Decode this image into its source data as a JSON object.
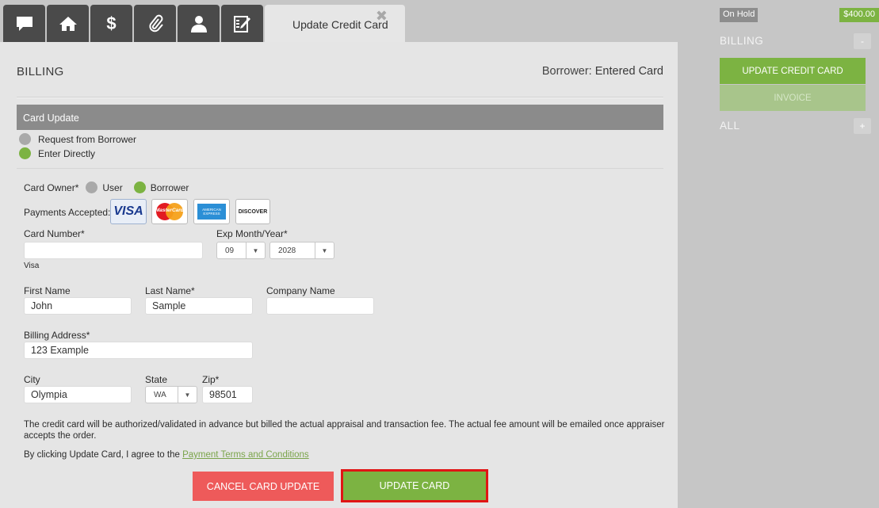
{
  "tabs": {
    "icons": [
      "chat-icon",
      "home-icon",
      "dollar-icon",
      "paperclip-icon",
      "user-icon",
      "edit-icon"
    ],
    "active_title": "Update Credit Card",
    "close_glyph": "✖"
  },
  "main": {
    "title": "BILLING",
    "borrower_prefix": "Borrower:",
    "borrower_value": "Entered Card",
    "section_title": "Card Update",
    "options": {
      "request": "Request from Borrower",
      "direct": "Enter Directly"
    },
    "card_owner": {
      "label": "Card Owner*",
      "user": "User",
      "borrower": "Borrower"
    },
    "payments_label": "Payments Accepted:",
    "cards": {
      "visa": "VISA",
      "mastercard": "MasterCard",
      "amex": "AMERICAN EXPRESS",
      "discover": "DISCOVER"
    },
    "card_number": {
      "label": "Card Number*",
      "value": "",
      "type_note": "Visa"
    },
    "exp": {
      "label": "Exp Month/Year*",
      "month": "09",
      "year": "2028"
    },
    "first_name": {
      "label": "First Name",
      "value": "John"
    },
    "last_name": {
      "label": "Last Name*",
      "value": "Sample"
    },
    "company": {
      "label": "Company Name",
      "value": ""
    },
    "address": {
      "label": "Billing Address*",
      "value": "123 Example"
    },
    "city": {
      "label": "City",
      "value": "Olympia"
    },
    "state": {
      "label": "State",
      "value": "WA"
    },
    "zip": {
      "label": "Zip*",
      "value": "98501"
    },
    "notice": "The credit card will be authorized/validated in advance but billed the actual appraisal and transaction fee. The actual fee amount will be emailed once appraiser accepts the order.",
    "agree_prefix": "By clicking Update Card, I agree to the",
    "agree_link": "Payment Terms and Conditions",
    "cancel_label": "CANCEL CARD UPDATE",
    "update_label": "UPDATE CARD"
  },
  "sidebar": {
    "status": "On Hold",
    "amount": "$400.00",
    "billing_title": "BILLING",
    "billing_toggle": "-",
    "update_cc": "UPDATE CREDIT CARD",
    "invoice": "INVOICE",
    "all_title": "ALL",
    "all_toggle": "+"
  },
  "colors": {
    "accent_green": "#7cb342",
    "cancel_red": "#ee5a5a",
    "highlight_border": "#e01515",
    "tab_dark": "#4a4a4a"
  }
}
